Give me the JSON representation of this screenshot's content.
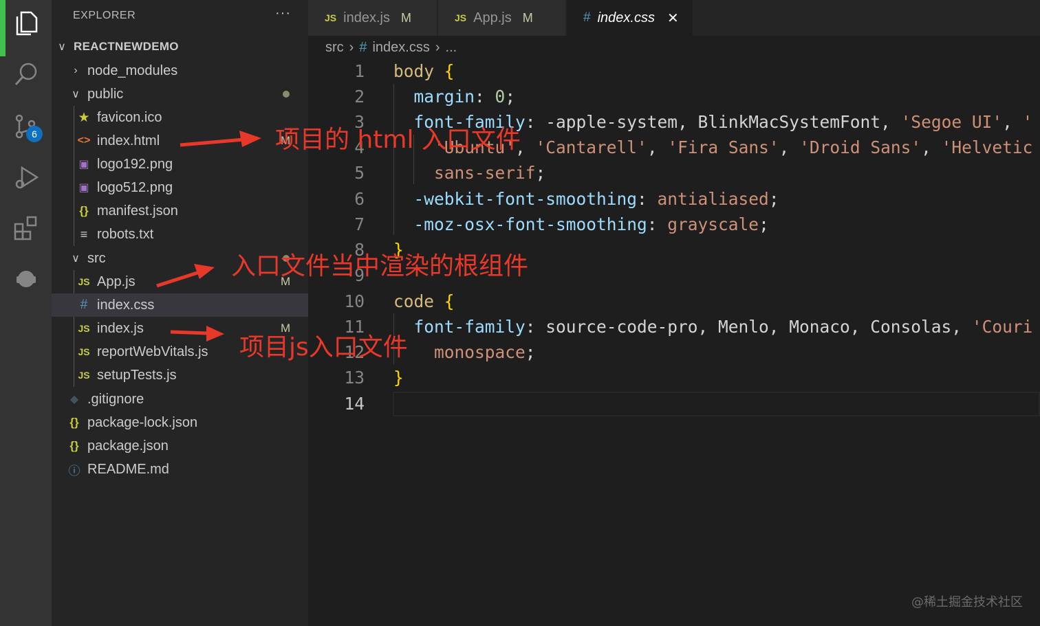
{
  "activity_bar": {
    "items": [
      {
        "name": "explorer",
        "icon": "files-icon"
      },
      {
        "name": "search",
        "icon": "search-icon"
      },
      {
        "name": "source-control",
        "icon": "source-control-icon",
        "badge": "6"
      },
      {
        "name": "run-debug",
        "icon": "run-debug-icon"
      },
      {
        "name": "extensions",
        "icon": "extensions-icon"
      },
      {
        "name": "live-share",
        "icon": "live-share-icon"
      }
    ],
    "accent_color": "#3fc14c"
  },
  "sidebar": {
    "title": "EXPLORER",
    "more": "···",
    "root": "REACTNEWDEMO",
    "tree": {
      "node_modules": "node_modules",
      "public": "public",
      "favicon": "favicon.ico",
      "index_html": "index.html",
      "logo192": "logo192.png",
      "logo512": "logo512.png",
      "manifest": "manifest.json",
      "robots": "robots.txt",
      "src": "src",
      "app_js": "App.js",
      "index_css": "index.css",
      "index_js": "index.js",
      "report": "reportWebVitals.js",
      "setup": "setupTests.js",
      "gitignore": ".gitignore",
      "pkg_lock": "package-lock.json",
      "pkg": "package.json",
      "readme": "README.md"
    },
    "modified_marker": "M"
  },
  "tabs": [
    {
      "icon": "JS",
      "label": "index.js",
      "status": "M"
    },
    {
      "icon": "JS",
      "label": "App.js",
      "status": "M"
    },
    {
      "icon": "#",
      "label": "index.css",
      "close": "✕"
    }
  ],
  "breadcrumb": {
    "folder": "src",
    "file": "index.css",
    "more": "..."
  },
  "editor": {
    "line_numbers": [
      "1",
      "2",
      "3",
      "4",
      "5",
      "6",
      "7",
      "8",
      "9",
      "10",
      "11",
      "12",
      "13",
      "14"
    ],
    "current_line": "14",
    "lines": {
      "l1_sel": "body",
      "l2_prop": "margin",
      "l2_num": "0",
      "l3_prop": "font-family",
      "l3_plain": "-apple-system, BlinkMacSystemFont, ",
      "l3_str1": "'Segoe UI'",
      "l3_str2": "'",
      "l4_str1": "'Ubuntu'",
      "l4_str2": "'Cantarell'",
      "l4_str3": "'Fira Sans'",
      "l4_str4": "'Droid Sans'",
      "l4_str5": "'Helvetic",
      "l5_val": "sans-serif",
      "l6_prop": "-webkit-font-smoothing",
      "l6_val": "antialiased",
      "l7_prop": "-moz-osx-font-smoothing",
      "l7_val": "grayscale",
      "l10_sel": "code",
      "l11_prop": "font-family",
      "l11_plain": "source-code-pro, Menlo, Monaco, Consolas, ",
      "l11_str": "'Couri",
      "l12_val": "monospace"
    }
  },
  "annotations": {
    "html_entry": "项目的 html 入口文件",
    "root_component": "入口文件当中渲染的根组件",
    "js_entry": "项目js入口文件",
    "color": "#e8382a"
  },
  "watermark": "@稀土掘金技术社区"
}
